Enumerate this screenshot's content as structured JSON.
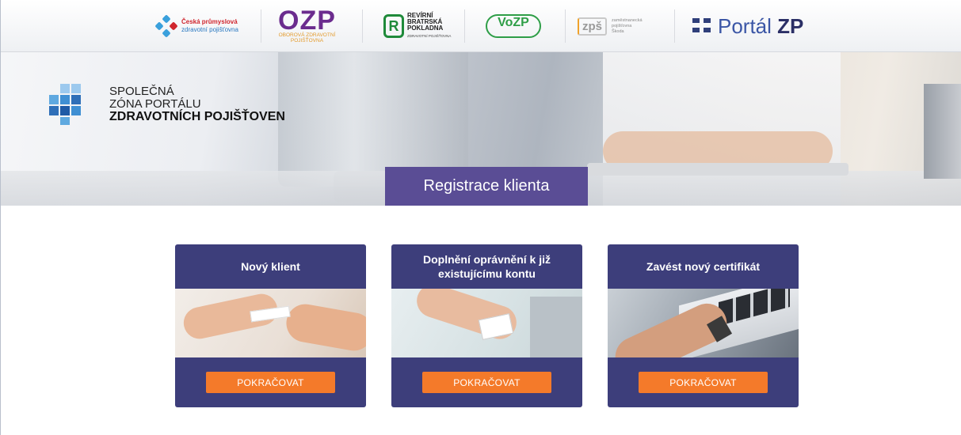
{
  "logos": {
    "cpzp_line1": "Česká průmyslová",
    "cpzp_line2": "zdravotní pojišťovna",
    "ozp_big": "OZP",
    "ozp_line1": "OBOROVÁ ZDRAVOTNÍ",
    "ozp_line2": "POJIŠŤOVNA",
    "rbp_letter": "R",
    "rbp_line1": "REVÍRNÍ",
    "rbp_line2": "BRATRSKÁ",
    "rbp_line3": "POKLADNA",
    "rbp_sub": "ZDRAVOTNÍ POJIŠŤOVNA",
    "vozp": "VoZP",
    "zps_box": "zpš",
    "zps_line1": "zaměstnanecká",
    "zps_line2": "pojišťovna",
    "zps_line3": "Škoda",
    "portal_light": "Portál ",
    "portal_bold": "ZP"
  },
  "brand": {
    "line1": "SPOLEČNÁ",
    "line2": "ZÓNA PORTÁLU",
    "line3": "ZDRAVOTNÍCH POJIŠŤOVEN"
  },
  "hero": {
    "title": "Registrace klienta"
  },
  "cards": [
    {
      "title": "Nový klient",
      "button": "POKRAČOVAT"
    },
    {
      "title": "Doplnění oprávnění k již existujícímu kontu",
      "button": "POKRAČOVAT"
    },
    {
      "title": "Zavést nový certifikát",
      "button": "POKRAČOVAT"
    }
  ],
  "colors": {
    "card_bg": "#3d3e7b",
    "hero_title_bg": "#5a4d95",
    "button": "#f47a2a"
  }
}
